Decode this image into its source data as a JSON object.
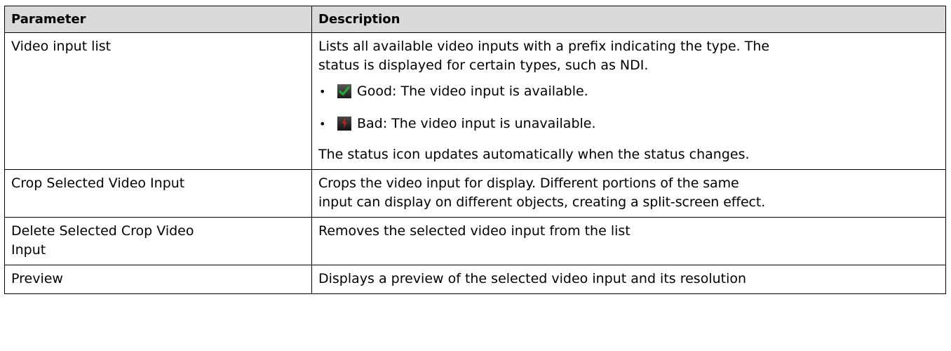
{
  "table": {
    "headers": {
      "parameter": "Parameter",
      "description": "Description"
    },
    "rows": [
      {
        "parameter": "Video input list",
        "description_lines": [
          "Lists all available video inputs with a prefix indicating the type. The",
          "status is displayed for certain types, such as NDI."
        ],
        "status_items": [
          {
            "icon": "green-checkmark-icon",
            "text": "Good: The video input is available.",
            "color": "#22a830"
          },
          {
            "icon": "red-bolt-icon",
            "text": "Bad: The video input is unavailable.",
            "color": "#e02010"
          }
        ],
        "bullet": "•",
        "note": "The status icon updates automatically when the status changes."
      },
      {
        "parameter": "Crop Selected Video Input",
        "description_lines": [
          "Crops the video input for display. Different portions of the same",
          "input can display on different objects, creating a split-screen effect."
        ]
      },
      {
        "parameter_lines": [
          "Delete Selected Crop Video",
          "Input"
        ],
        "description_lines": [
          "Removes the selected video input from the list"
        ]
      },
      {
        "parameter": "Preview",
        "description_lines": [
          "Displays a preview of the selected video input and its resolution"
        ]
      }
    ]
  }
}
